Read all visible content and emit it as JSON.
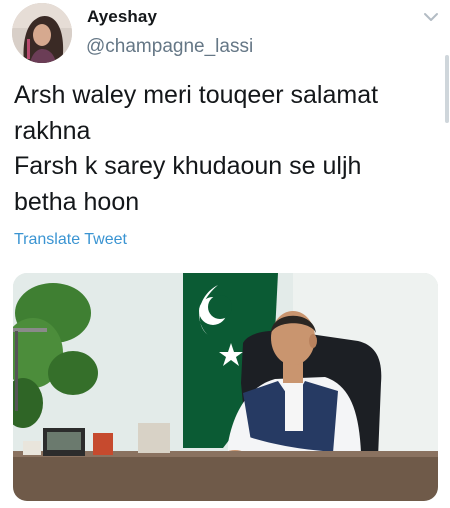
{
  "author": {
    "display_name": "Ayeshay",
    "handle": "@champagne_lassi"
  },
  "tweet": {
    "lines": [
      "Arsh waley meri touqeer salamat",
      "rakhna",
      "Farsh k sarey khudaoun se uljh",
      "betha hoon"
    ],
    "translate_label": "Translate Tweet"
  },
  "icons": {
    "menu": "chevron-down-icon",
    "avatar": "avatar-photo",
    "media": "office-photo"
  },
  "colors": {
    "name_text": "#14171a",
    "handle_text": "#657786",
    "link": "#3a94d2",
    "flag_green": "#0b5b34"
  }
}
